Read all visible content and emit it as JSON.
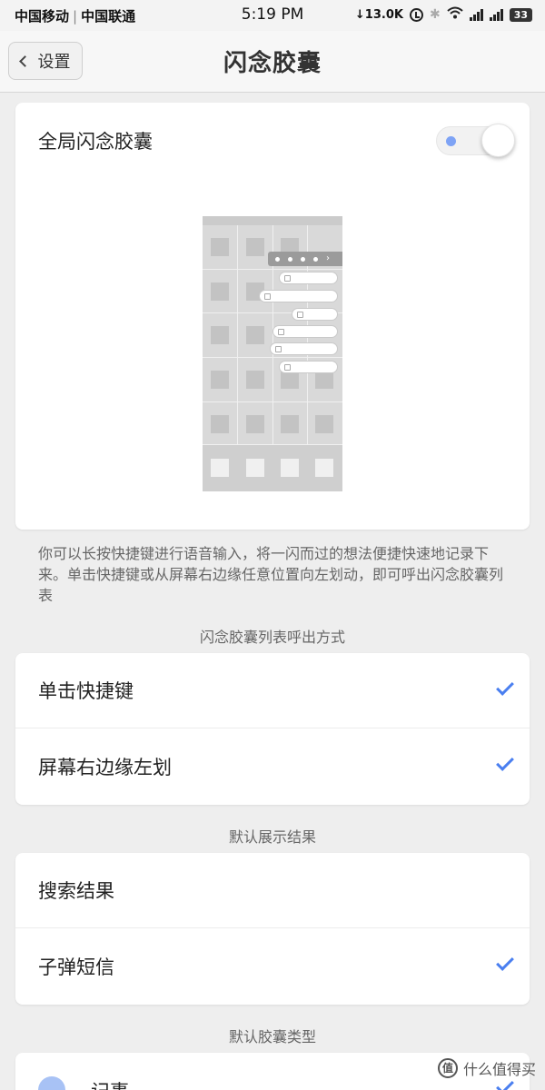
{
  "status_bar": {
    "carrier1": "中国移动",
    "carrier2": "中国联通",
    "time": "5:19 PM",
    "speed": "↓13.0K",
    "battery": "33"
  },
  "header": {
    "back_label": "设置",
    "title": "闪念胶囊"
  },
  "global_toggle": {
    "label": "全局闪念胶囊",
    "enabled": true
  },
  "description": "你可以长按快捷键进行语音输入，将一闪而过的想法便捷快速地记录下来。单击快捷键或从屏幕右边缘任意位置向左划动，即可呼出闪念胶囊列表",
  "section_invoke": {
    "title": "闪念胶囊列表呼出方式",
    "options": [
      {
        "label": "单击快捷键",
        "checked": true
      },
      {
        "label": "屏幕右边缘左划",
        "checked": true
      }
    ]
  },
  "section_result": {
    "title": "默认展示结果",
    "options": [
      {
        "label": "搜索结果",
        "checked": false
      },
      {
        "label": "子弹短信",
        "checked": true
      }
    ]
  },
  "section_type": {
    "title": "默认胶囊类型",
    "partial_item": {
      "label": "记事",
      "icon": "note-icon",
      "checked": true
    }
  },
  "watermark": {
    "logo": "值",
    "text": "什么值得买"
  },
  "colors": {
    "accent": "#4a7ff0",
    "background": "#eeeeee",
    "card": "#ffffff"
  }
}
